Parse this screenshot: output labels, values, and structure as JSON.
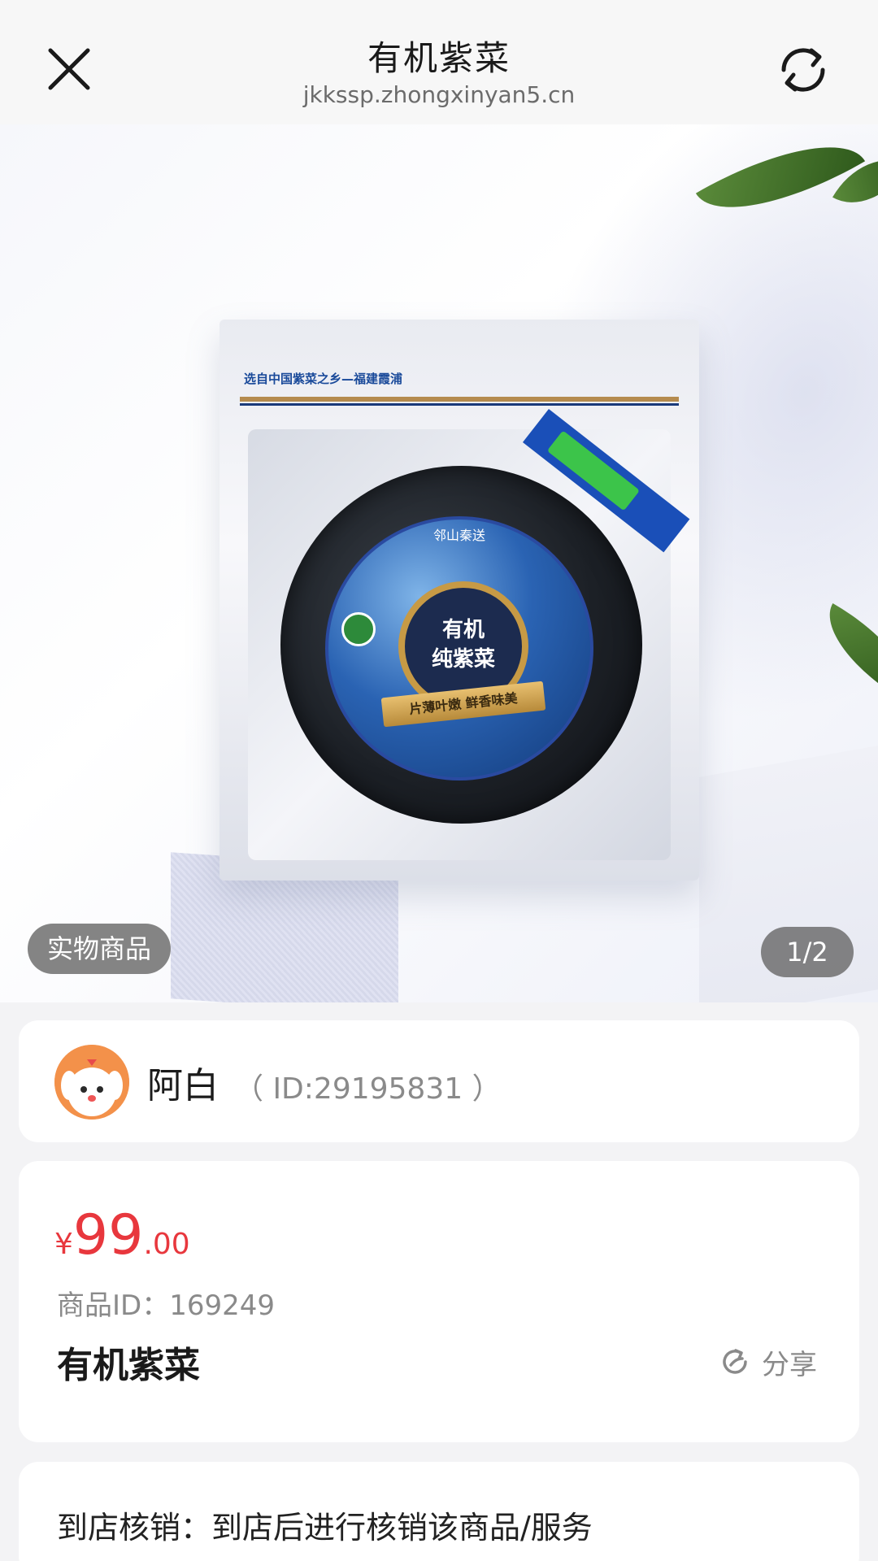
{
  "header": {
    "title": "有机紫菜",
    "url": "jkkssp.zhongxinyan5.cn",
    "close_icon": "close-icon",
    "refresh_icon": "refresh-icon"
  },
  "gallery": {
    "tag": "实物商品",
    "page_indicator": "1/2",
    "package": {
      "origin_text": "选自中国紫菜之乡—福建霞浦",
      "brand": "邻山秦送",
      "seal_line1": "有机",
      "seal_line2": "纯紫菜",
      "ribbon_text": "片薄叶嫩 鲜香味美"
    }
  },
  "shop": {
    "name": "阿白",
    "id_text": "（ ID:29195831 ）"
  },
  "product": {
    "price_symbol": "¥",
    "price_integer": "99",
    "price_decimal": ".00",
    "id_text": "商品ID：169249",
    "name": "有机紫菜",
    "share_label": "分享",
    "share_icon": "share-icon"
  },
  "redeem": {
    "text": "到店核销：到店后进行核销该商品/服务"
  },
  "colors": {
    "price": "#e8373d",
    "background": "#f3f3f5",
    "card": "#ffffff"
  }
}
